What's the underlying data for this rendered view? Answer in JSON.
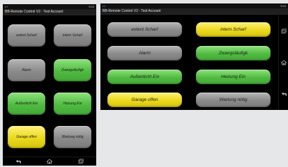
{
  "status": {
    "time": "9:24",
    "icons": [
      "usb-icon",
      "wifi-icon",
      "signal-icon",
      "battery-icon"
    ]
  },
  "app": {
    "title": "BB-Remote Control V2",
    "account": "Test Account"
  },
  "buttons": {
    "extent_scharf": "extent Scharf",
    "intern_scharf": "intern Scharf",
    "alarm": "Alarm",
    "zwangslaeufig": "Zwangsläufigk",
    "aussenlicht_ein": "Außenlicht Ein",
    "heizung_ein": "Heizung Ein",
    "garage_offen": "Garage offen",
    "wartung_noetig": "Wartung nötig"
  },
  "colors": {
    "gray": "#8c8c8c",
    "green": "#4cbb3f",
    "yellow": "#ead91d",
    "background": "#000000"
  },
  "nav_icons": [
    "back-icon",
    "home-icon",
    "recent-apps-icon"
  ]
}
